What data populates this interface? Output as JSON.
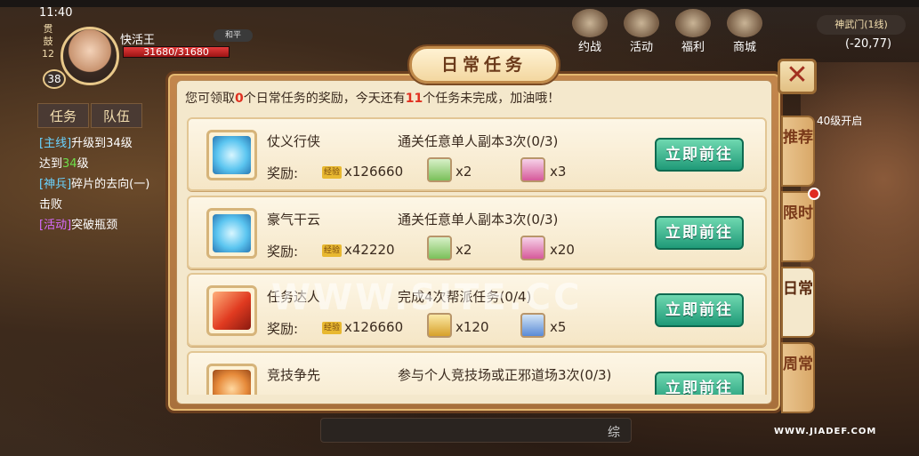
{
  "status": {
    "time": "11:40"
  },
  "player": {
    "rank_chars": [
      "贯",
      "鼓",
      "12"
    ],
    "level": "38",
    "name": "快活王",
    "hp_text": "31680/31680",
    "hp_fraction": 1.0,
    "tag": "和平"
  },
  "side_tabs": [
    "任务",
    "队伍"
  ],
  "quest_log": [
    {
      "tag": "[主线]",
      "text": "升级到34级"
    },
    {
      "text_pre": "达到",
      "highlight": "34",
      "text_post": "级"
    },
    {
      "tag": "[神兵]",
      "text": "碎片的去向(一)"
    },
    {
      "text": "击败"
    },
    {
      "tag": "[活动]",
      "text": "突破瓶颈"
    }
  ],
  "top_menu": [
    "约战",
    "活动",
    "福利",
    "商城"
  ],
  "location": {
    "name": "神武门(1线)",
    "coords": "(-20,77)"
  },
  "side_hint": "40级开启",
  "dialog": {
    "title": "日常任务",
    "summary": {
      "part1": "您可领取",
      "claimable": "0",
      "part2": "个日常任务的奖励，今天还有",
      "remaining": "11",
      "part3": "个任务未完成，加油哦！"
    },
    "reward_label": "奖励:",
    "exp_tag": "经验",
    "tasks": [
      {
        "name": "仗义行侠",
        "desc": "通关任意单人副本3次(0/3)",
        "exp": "x126660",
        "items": [
          {
            "kind": "green",
            "qty": "x2"
          },
          {
            "kind": "pink",
            "qty": "x3"
          }
        ],
        "button": "立即前往",
        "icon": "blue"
      },
      {
        "name": "豪气干云",
        "desc": "通关任意单人副本3次(0/3)",
        "exp": "x42220",
        "items": [
          {
            "kind": "green",
            "qty": "x2"
          },
          {
            "kind": "pink",
            "qty": "x20"
          }
        ],
        "button": "立即前往",
        "icon": "blue"
      },
      {
        "name": "任务达人",
        "desc": "完成4次帮派任务(0/4)",
        "exp": "x126660",
        "items": [
          {
            "kind": "gold",
            "qty": "x120"
          },
          {
            "kind": "blue",
            "qty": "x5"
          }
        ],
        "button": "立即前往",
        "icon": "red"
      },
      {
        "name": "竞技争先",
        "desc": "参与个人竞技场或正邪道场3次(0/3)",
        "exp": "",
        "items": [],
        "button": "立即前往",
        "icon": "orange"
      }
    ],
    "tabs": [
      "推荐",
      "限时",
      "日常",
      "周常"
    ],
    "active_tab": 2
  },
  "watermark_center": "WWW.SITE.CC",
  "watermark_corner": "WWW.JIADEF.COM",
  "chat_char": "综"
}
